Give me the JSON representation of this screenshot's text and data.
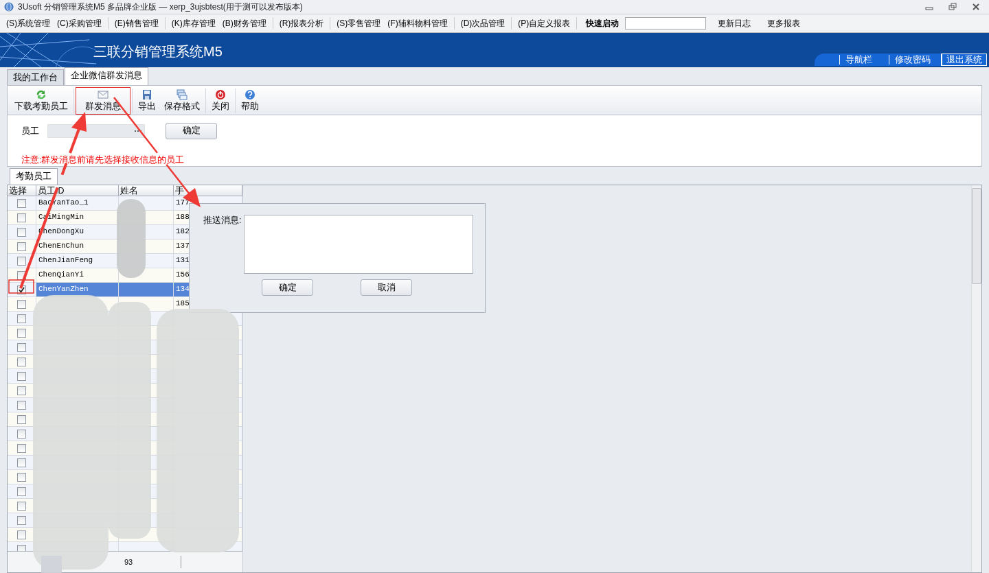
{
  "window": {
    "title": "3Usoft 分销管理系统M5 多品牌企业版 — xerp_3ujsbtest(用于测可以发布版本)"
  },
  "menu": [
    {
      "label": "(S)系统管理",
      "group_start": false
    },
    {
      "label": "(C)采购管理",
      "group_start": false
    },
    {
      "label": "(E)销售管理",
      "group_start": true
    },
    {
      "label": "(K)库存管理",
      "group_start": true
    },
    {
      "label": "(B)财务管理",
      "group_start": false
    },
    {
      "label": "(R)报表分析",
      "group_start": true
    },
    {
      "label": "(S)零售管理",
      "group_start": true
    },
    {
      "label": "(F)辅料物料管理",
      "group_start": false
    },
    {
      "label": "(D)次品管理",
      "group_start": true
    },
    {
      "label": "(P)自定义报表",
      "group_start": true
    }
  ],
  "quick_launch": {
    "label": "快速启动"
  },
  "menu_links": [
    "更新日志",
    "更多报表"
  ],
  "banner": {
    "title": "三联分销管理系统M5",
    "links": [
      "导航栏",
      "修改密码",
      "退出系统"
    ]
  },
  "tabs": [
    {
      "label": "我的工作台",
      "selected": false
    },
    {
      "label": "企业微信群发消息",
      "selected": true
    }
  ],
  "toolbar": [
    {
      "label": "下载考勤员工",
      "kind": "refresh",
      "highlighted": false
    },
    {
      "label": "群发消息",
      "kind": "mail",
      "highlighted": true
    },
    {
      "label": "导出",
      "kind": "save",
      "highlighted": false
    },
    {
      "label": "保存格式",
      "kind": "windows",
      "highlighted": false
    },
    {
      "label": "关闭",
      "kind": "power",
      "highlighted": false
    },
    {
      "label": "帮助",
      "kind": "help",
      "highlighted": false
    }
  ],
  "filter": {
    "label": "员工",
    "button": "确定",
    "notice": "注意:群发消息前请先选择接收信息的员工"
  },
  "grid_tab": "考勤员工",
  "table": {
    "columns": [
      "选择",
      "员工ID",
      "姓名",
      "手"
    ],
    "rows": [
      {
        "checked": false,
        "selected": false,
        "id": "BaoYanTao_1",
        "phone": "177"
      },
      {
        "checked": false,
        "selected": false,
        "id": "CaiMingMin",
        "phone": "188"
      },
      {
        "checked": false,
        "selected": false,
        "id": "ChenDongXu",
        "phone": "182"
      },
      {
        "checked": false,
        "selected": false,
        "id": "ChenEnChun",
        "phone": "137"
      },
      {
        "checked": false,
        "selected": false,
        "id": "ChenJianFeng",
        "phone": "131"
      },
      {
        "checked": false,
        "selected": false,
        "id": "ChenQianYi",
        "phone": "156"
      },
      {
        "checked": true,
        "selected": true,
        "id": "ChenYanZhen",
        "phone": "134"
      },
      {
        "checked": false,
        "selected": false,
        "id": "",
        "phone": "185"
      },
      {
        "checked": false,
        "selected": false,
        "id": "",
        "phone": ""
      },
      {
        "checked": false,
        "selected": false,
        "id": "",
        "phone": ""
      },
      {
        "checked": false,
        "selected": false,
        "id": "",
        "phone": ""
      },
      {
        "checked": false,
        "selected": false,
        "id": "",
        "phone": ""
      },
      {
        "checked": false,
        "selected": false,
        "id": "",
        "phone": ""
      },
      {
        "checked": false,
        "selected": false,
        "id": "",
        "phone": ""
      },
      {
        "checked": false,
        "selected": false,
        "id": "",
        "phone": ""
      },
      {
        "checked": false,
        "selected": false,
        "id": "",
        "phone": ""
      },
      {
        "checked": false,
        "selected": false,
        "id": "",
        "phone": ""
      },
      {
        "checked": false,
        "selected": false,
        "id": "",
        "phone": ""
      },
      {
        "checked": false,
        "selected": false,
        "id": "",
        "phone": ""
      },
      {
        "checked": false,
        "selected": false,
        "id": "",
        "phone": ""
      },
      {
        "checked": false,
        "selected": false,
        "id": "",
        "phone": ""
      },
      {
        "checked": false,
        "selected": false,
        "id": "",
        "phone": ""
      },
      {
        "checked": false,
        "selected": false,
        "id": "",
        "phone": ""
      },
      {
        "checked": false,
        "selected": false,
        "id": "",
        "phone": ""
      },
      {
        "checked": false,
        "selected": false,
        "id": "",
        "phone": ""
      }
    ],
    "footer": "93"
  },
  "dialog": {
    "label": "推送消息:",
    "ok": "确定",
    "cancel": "取消"
  }
}
